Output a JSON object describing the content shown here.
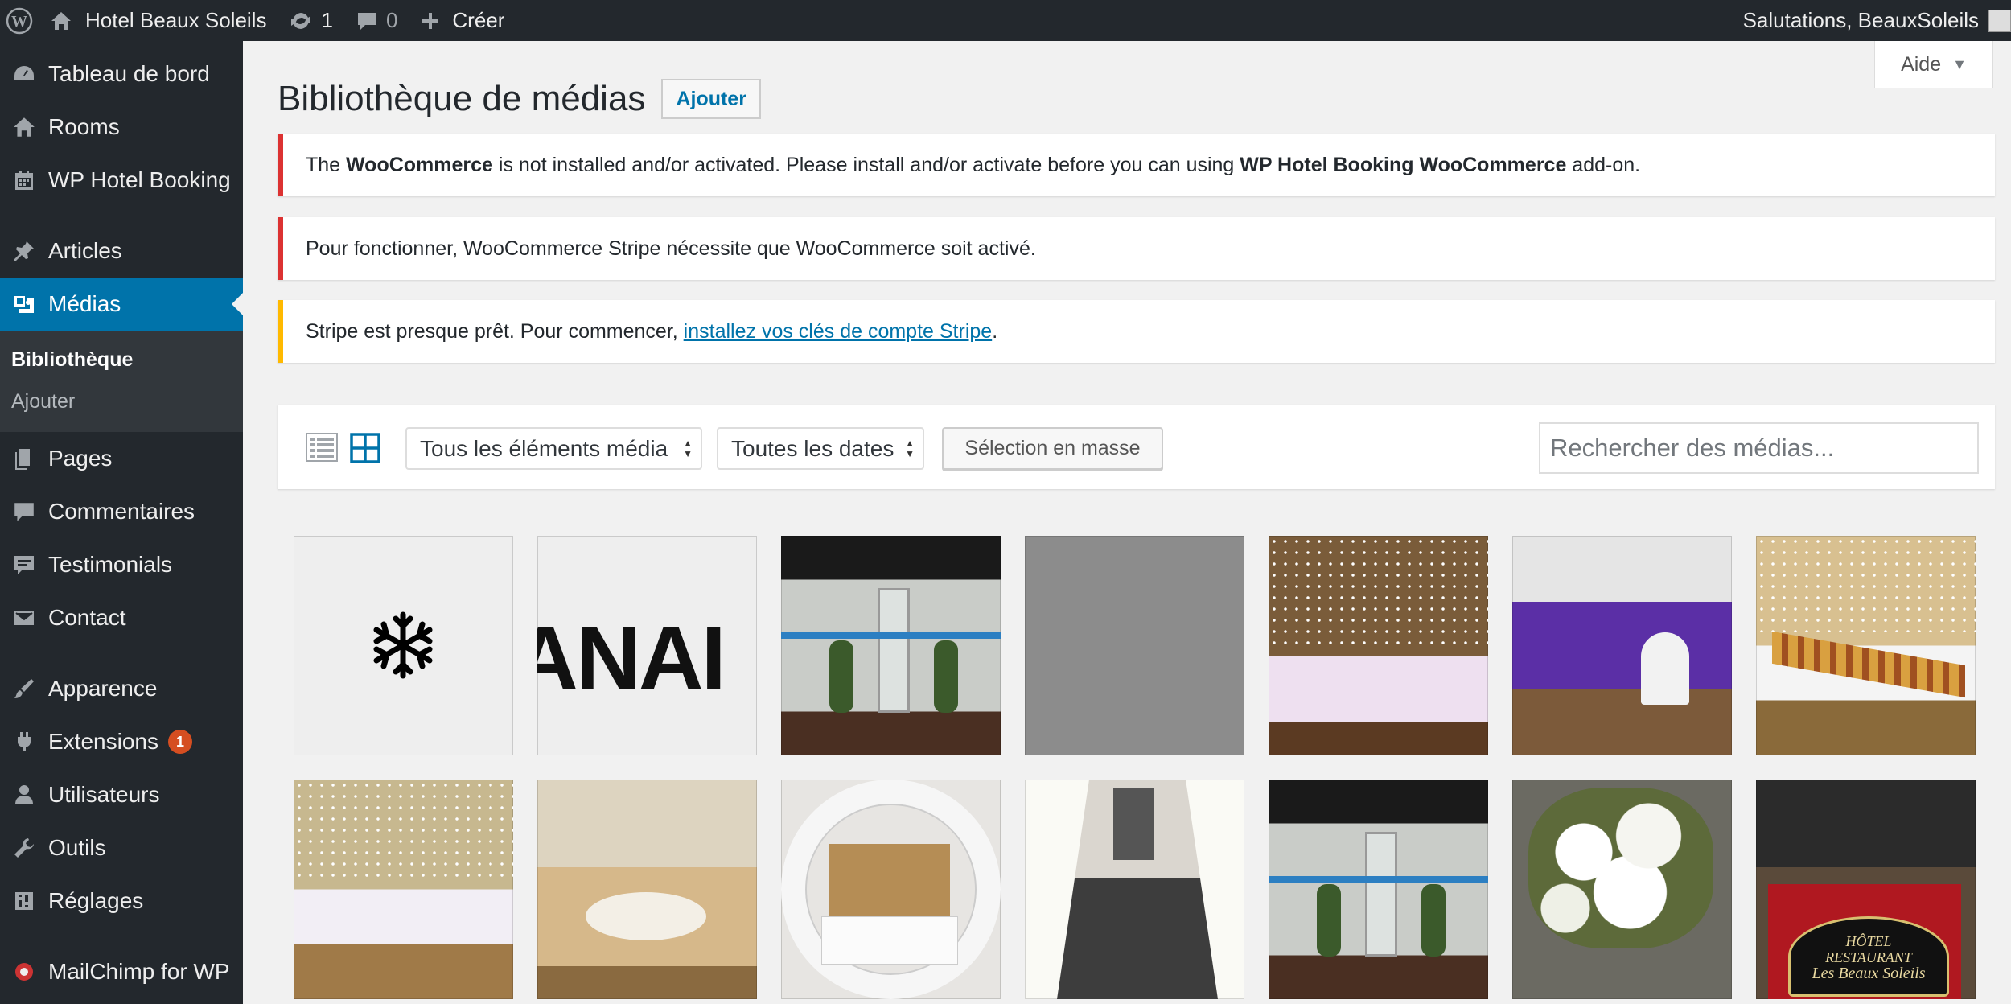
{
  "admin_bar": {
    "site_name": "Hotel Beaux Soleils",
    "updates_count": "1",
    "comments_count": "0",
    "new_label": "Créer",
    "greeting": "Salutations, BeauxSoleils"
  },
  "sidebar": {
    "items": [
      {
        "label": "Tableau de bord",
        "icon": "dashboard-icon"
      },
      {
        "label": "Rooms",
        "icon": "home-icon"
      },
      {
        "label": "WP Hotel Booking",
        "icon": "calendar-icon"
      },
      {
        "label": "Articles",
        "icon": "pin-icon"
      },
      {
        "label": "Médias",
        "icon": "media-icon"
      },
      {
        "label": "Pages",
        "icon": "pages-icon"
      },
      {
        "label": "Commentaires",
        "icon": "comment-icon"
      },
      {
        "label": "Testimonials",
        "icon": "testimonial-icon"
      },
      {
        "label": "Contact",
        "icon": "mail-icon"
      },
      {
        "label": "Apparence",
        "icon": "brush-icon"
      },
      {
        "label": "Extensions",
        "icon": "plugin-icon",
        "badge": "1"
      },
      {
        "label": "Utilisateurs",
        "icon": "user-icon"
      },
      {
        "label": "Outils",
        "icon": "wrench-icon"
      },
      {
        "label": "Réglages",
        "icon": "settings-icon"
      },
      {
        "label": "MailChimp for WP",
        "icon": "mailchimp-icon"
      }
    ],
    "submenu": {
      "library": "Bibliothèque",
      "add": "Ajouter"
    }
  },
  "header": {
    "help_label": "Aide",
    "title": "Bibliothèque de médias",
    "add_button": "Ajouter"
  },
  "notices": {
    "woocommerce": {
      "prefix": "The ",
      "plugin": "WooCommerce",
      "middle": " is not installed and/or activated. Please install and/or activate before you can using ",
      "addon": "WP Hotel Booking WooCommerce",
      "suffix": " add-on."
    },
    "stripe_error": "Pour fonctionner, WooCommerce Stripe nécessite que WooCommerce soit activé.",
    "stripe_warning": {
      "text": "Stripe est presque prêt. Pour commencer, ",
      "link": "installez vos clés de compte Stripe",
      "end": "."
    }
  },
  "toolbar": {
    "filter_type": "Tous les éléments média",
    "filter_date": "Toutes les dates",
    "bulk_select": "Sélection en masse",
    "search_placeholder": "Rechercher des médias..."
  },
  "media": {
    "items": [
      {
        "name": "snowflake-logo"
      },
      {
        "name": "text-logo",
        "text": "ANAI"
      },
      {
        "name": "lobby-entrance"
      },
      {
        "name": "gray-placeholder"
      },
      {
        "name": "buffet-lights"
      },
      {
        "name": "purple-reception-room"
      },
      {
        "name": "buffet-table"
      },
      {
        "name": "buffet-curtain-lights"
      },
      {
        "name": "banquet-tables"
      },
      {
        "name": "hotel-room-bed"
      },
      {
        "name": "hotel-corridor"
      },
      {
        "name": "lobby-entrance-2"
      },
      {
        "name": "white-flowers"
      },
      {
        "name": "reception-desk",
        "text_lines": [
          "HÔTEL",
          "RESTAURANT",
          "Les Beaux Soleils"
        ]
      }
    ]
  }
}
